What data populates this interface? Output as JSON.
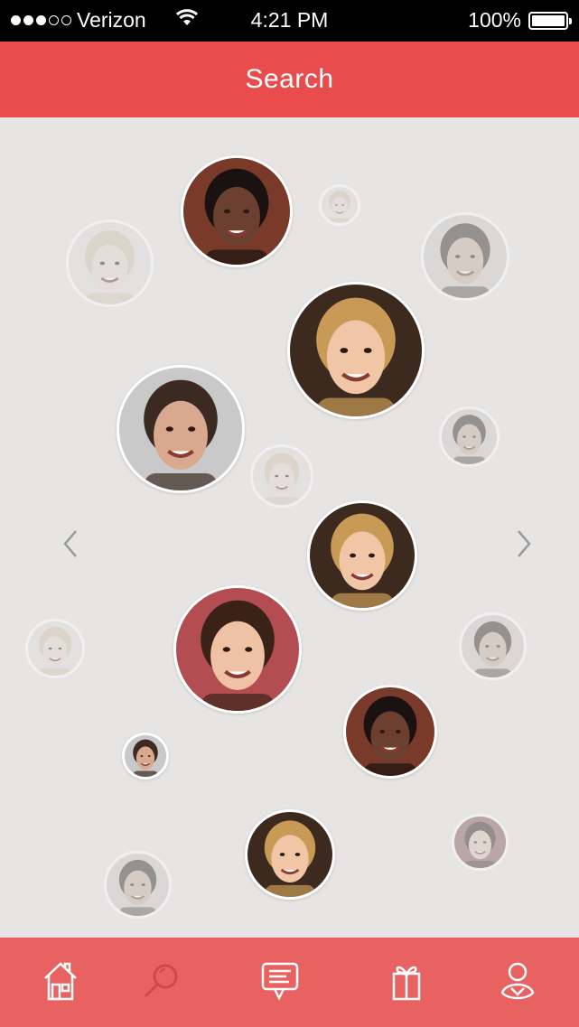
{
  "status_bar": {
    "signal_dots_filled": 3,
    "signal_dots_total": 5,
    "carrier": "Verizon",
    "time": "4:21 PM",
    "battery": "100%"
  },
  "header": {
    "title": "Search"
  },
  "colors": {
    "brand_red": "#e84c4c",
    "tabbar_red": "#e86262",
    "background": "#e7e5e4"
  },
  "profiles": [
    {
      "name": "profile-bubble-1",
      "style": "sharp",
      "tone": "dark"
    },
    {
      "name": "profile-bubble-2",
      "style": "faded",
      "tone": "light"
    },
    {
      "name": "profile-bubble-3",
      "style": "faded",
      "tone": "light"
    },
    {
      "name": "profile-bubble-4",
      "style": "faded",
      "tone": "medium"
    },
    {
      "name": "profile-bubble-5",
      "style": "sharp",
      "tone": "blonde"
    },
    {
      "name": "profile-bubble-6",
      "style": "sharp",
      "tone": "medium"
    },
    {
      "name": "profile-bubble-7",
      "style": "faded",
      "tone": "medium"
    },
    {
      "name": "profile-bubble-8",
      "style": "faded",
      "tone": "light"
    },
    {
      "name": "profile-bubble-9",
      "style": "sharp",
      "tone": "blonde"
    },
    {
      "name": "profile-bubble-10",
      "style": "faded",
      "tone": "light"
    },
    {
      "name": "profile-bubble-11",
      "style": "sharp",
      "tone": "brunette"
    },
    {
      "name": "profile-bubble-12",
      "style": "faded",
      "tone": "medium"
    },
    {
      "name": "profile-bubble-13",
      "style": "sharp",
      "tone": "dark"
    },
    {
      "name": "profile-bubble-14",
      "style": "sharp",
      "tone": "medium"
    },
    {
      "name": "profile-bubble-15",
      "style": "sharp",
      "tone": "blonde"
    },
    {
      "name": "profile-bubble-16",
      "style": "faded",
      "tone": "brunette"
    },
    {
      "name": "profile-bubble-17",
      "style": "faded",
      "tone": "medium"
    }
  ],
  "navigation": {
    "prev_icon": "chevron-left-icon",
    "next_icon": "chevron-right-icon"
  },
  "tabbar": {
    "tabs": [
      {
        "name": "home",
        "icon": "house-icon",
        "active": false
      },
      {
        "name": "search",
        "icon": "magnifier-icon",
        "active": true
      },
      {
        "name": "messages",
        "icon": "chat-bubble-icon",
        "active": false
      },
      {
        "name": "gifts",
        "icon": "gift-icon",
        "active": false
      },
      {
        "name": "profile",
        "icon": "user-icon",
        "active": false
      }
    ]
  }
}
